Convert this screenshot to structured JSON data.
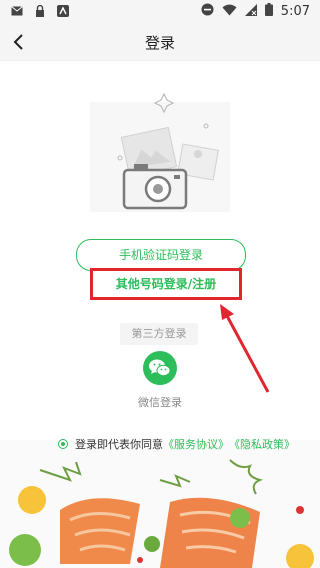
{
  "status_bar": {
    "time": "5:07",
    "icons": [
      "mail-icon",
      "lock-icon",
      "android-icon",
      "dnd-icon",
      "wifi-icon",
      "no-sim-icon",
      "battery-icon"
    ]
  },
  "header": {
    "back_icon": "chevron-left-icon",
    "title": "登录"
  },
  "login": {
    "phone_code_button": "手机验证码登录",
    "other_number_button": "其他号码登录/注册",
    "third_party_label": "第三方登录",
    "wechat_label": "微信登录",
    "agreement_prefix": "登录即代表你同意",
    "service_link": "《服务协议》",
    "privacy_link": "《隐私政策》"
  },
  "colors": {
    "accent": "#2dbd5a",
    "highlight": "#e0262e"
  }
}
